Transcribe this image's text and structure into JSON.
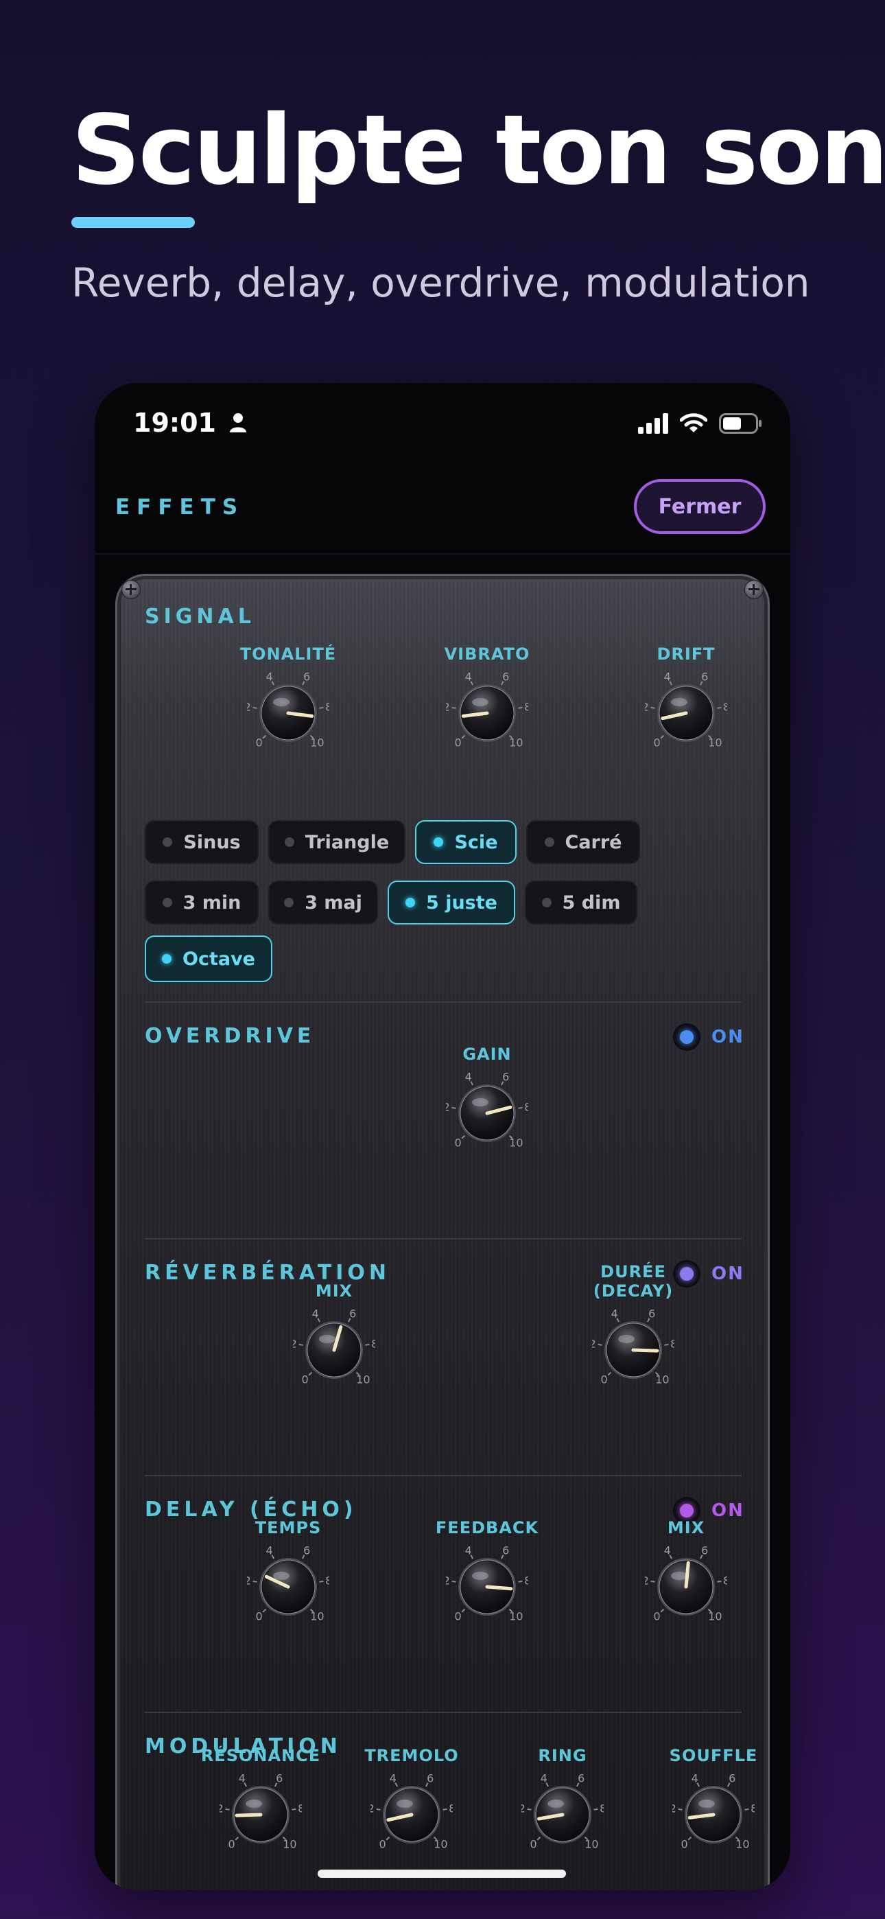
{
  "marketing": {
    "headline": "Sculpte ton son",
    "subheadline": "Reverb, delay, overdrive, modulation",
    "accent_color": "#6ad0f6"
  },
  "status_bar": {
    "time": "19:01",
    "icons": [
      "person-icon",
      "cellular-signal-icon",
      "wifi-icon",
      "battery-icon"
    ]
  },
  "nav": {
    "title": "EFFETS",
    "close_label": "Fermer"
  },
  "dial_scale": [
    "0",
    "2",
    "4",
    "6",
    "8",
    "10"
  ],
  "sections": {
    "signal": {
      "title": "SIGNAL",
      "knobs": [
        {
          "label": "TONALITÉ",
          "value": 8.6
        },
        {
          "label": "VIBRATO",
          "value": 1.4
        },
        {
          "label": "DRIFT",
          "value": 1.2
        }
      ],
      "waveforms": [
        {
          "label": "Sinus",
          "active": false
        },
        {
          "label": "Triangle",
          "active": false
        },
        {
          "label": "Scie",
          "active": true
        },
        {
          "label": "Carré",
          "active": false
        }
      ],
      "intervals": [
        {
          "label": "3 min",
          "active": false
        },
        {
          "label": "3 maj",
          "active": false
        },
        {
          "label": "5 juste",
          "active": true
        },
        {
          "label": "5 dim",
          "active": false
        },
        {
          "label": "Octave",
          "active": true
        }
      ]
    },
    "overdrive": {
      "title": "OVERDRIVE",
      "toggle_label": "ON",
      "toggle_color": "#4a8ff0",
      "knobs": [
        {
          "label": "GAIN",
          "value": 7.8
        }
      ]
    },
    "reverb": {
      "title": "RÉVERBÉRATION",
      "toggle_label": "ON",
      "toggle_color": "#8a7cf0",
      "knobs": [
        {
          "label": "MIX",
          "value": 5.6
        },
        {
          "label": "DURÉE\n(DECAY)",
          "value": 8.4
        }
      ]
    },
    "delay": {
      "title": "DELAY (ÉCHO)",
      "toggle_label": "ON",
      "toggle_color": "#b45ae8",
      "knobs": [
        {
          "label": "TEMPS",
          "value": 2.6
        },
        {
          "label": "FEEDBACK",
          "value": 8.5
        },
        {
          "label": "MIX",
          "value": 5.2
        }
      ]
    },
    "modulation": {
      "title": "MODULATION",
      "knobs": [
        {
          "label": "RÉSONANCE",
          "value": 1.6
        },
        {
          "label": "TREMOLO",
          "value": 1.2
        },
        {
          "label": "RING",
          "value": 1.3
        },
        {
          "label": "SOUFFLE",
          "value": 1.4
        }
      ]
    }
  }
}
